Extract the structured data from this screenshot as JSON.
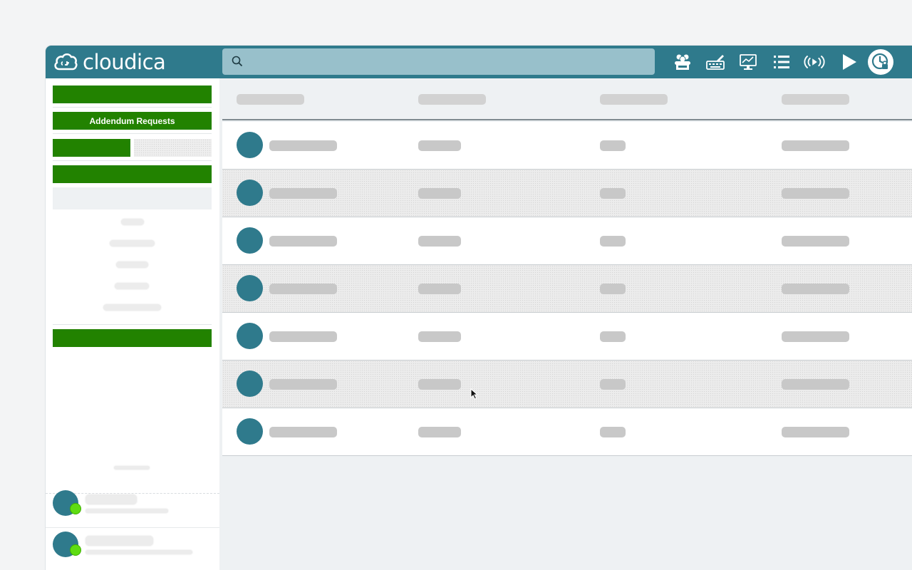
{
  "app": {
    "brand": "cloudica"
  },
  "search": {
    "value": ""
  },
  "toolbar": {
    "icons": [
      "users-icon",
      "keyboard-icon",
      "monitor-icon",
      "list-icon",
      "broadcast-icon",
      "play-icon",
      "clock-lock-icon"
    ]
  },
  "sidebar": {
    "addendum_label": "Addendum Requests"
  },
  "table": {
    "row_count": 7
  },
  "colors": {
    "topbar": "#2f7a8c",
    "search": "#98c0cb",
    "button_green": "#228200",
    "avatar": "#2f7a8c",
    "online": "#5fdc12"
  }
}
